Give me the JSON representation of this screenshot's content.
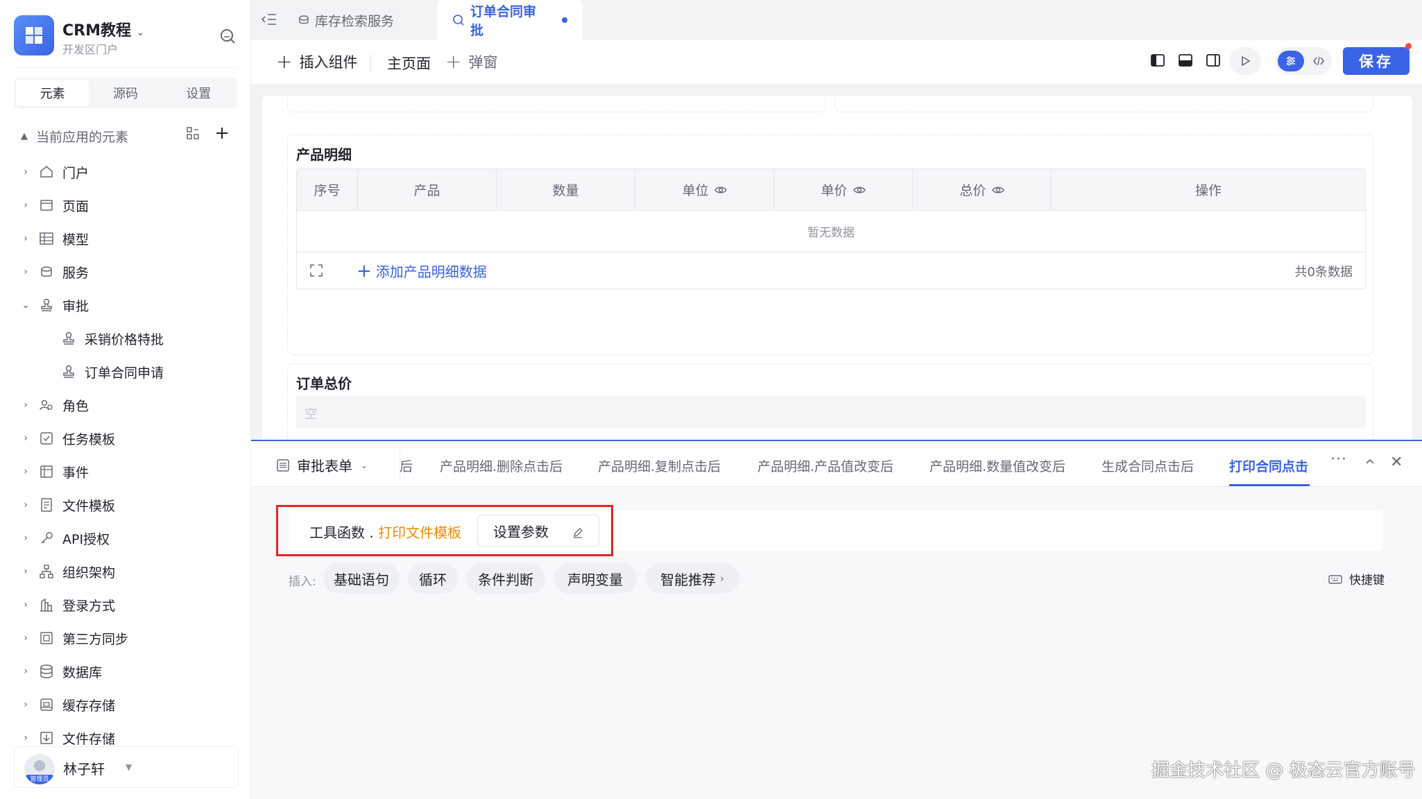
{
  "app": {
    "name": "CRM教程",
    "subtitle": "开发区门户"
  },
  "sidebar": {
    "tabs": [
      "元素",
      "源码",
      "设置"
    ],
    "active_tab": "元素",
    "tree_header": "当前应用的元素",
    "items": [
      {
        "label": "门户",
        "icon": "home-icon"
      },
      {
        "label": "页面",
        "icon": "page-icon"
      },
      {
        "label": "模型",
        "icon": "table-icon"
      },
      {
        "label": "服务",
        "icon": "service-icon"
      },
      {
        "label": "审批",
        "icon": "stamp-icon",
        "expanded": true
      },
      {
        "label": "采销价格特批",
        "icon": "stamp-icon",
        "child": true
      },
      {
        "label": "订单合同申请",
        "icon": "stamp-icon",
        "child": true
      },
      {
        "label": "角色",
        "icon": "role-icon"
      },
      {
        "label": "任务模板",
        "icon": "task-icon"
      },
      {
        "label": "事件",
        "icon": "event-icon"
      },
      {
        "label": "文件模板",
        "icon": "file-template-icon"
      },
      {
        "label": "API授权",
        "icon": "key-icon"
      },
      {
        "label": "组织架构",
        "icon": "org-icon"
      },
      {
        "label": "登录方式",
        "icon": "login-icon"
      },
      {
        "label": "第三方同步",
        "icon": "sync-icon"
      },
      {
        "label": "数据库",
        "icon": "database-icon"
      },
      {
        "label": "缓存存储",
        "icon": "cache-icon"
      },
      {
        "label": "文件存储",
        "icon": "file-storage-icon"
      }
    ],
    "user": {
      "name": "林子轩",
      "role_badge": "管理员"
    }
  },
  "tabs": [
    {
      "label": "库存检索服务",
      "active": false
    },
    {
      "label": "订单合同审批",
      "active": true
    }
  ],
  "toolbar": {
    "insert_component": "插入组件",
    "main_page": "主页面",
    "popup": "弹窗",
    "save": "保存"
  },
  "canvas": {
    "products_title": "产品明细",
    "columns": [
      "序号",
      "产品",
      "数量",
      "单位",
      "单价",
      "总价",
      "操作"
    ],
    "empty_text": "暂无数据",
    "add_row": "添加产品明细数据",
    "count_text": "共0条数据",
    "total_title": "订单总价",
    "total_placeholder": "空"
  },
  "panel": {
    "form_selector": "审批表单",
    "partial_tab": "后",
    "event_tabs": [
      "产品明细.删除点击后",
      "产品明细.复制点击后",
      "产品明细.产品值改变后",
      "产品明细.数量值改变后",
      "生成合同点击后",
      "打印合同点击"
    ],
    "active_event": "打印合同点击",
    "code_prefix": "工具函数 . ",
    "code_fn": "打印文件模板",
    "param_button": "设置参数",
    "insert_label": "插入:",
    "insert_chips": [
      "基础语句",
      "循环",
      "条件判断",
      "声明变量",
      "智能推荐"
    ],
    "shortcut": "快捷键"
  },
  "watermark": "掘金技术社区 @ 极态云官方账号",
  "colors": {
    "primary": "#3a63e6",
    "highlight_fn": "#f08c00",
    "annotation_red": "#e8251e"
  }
}
